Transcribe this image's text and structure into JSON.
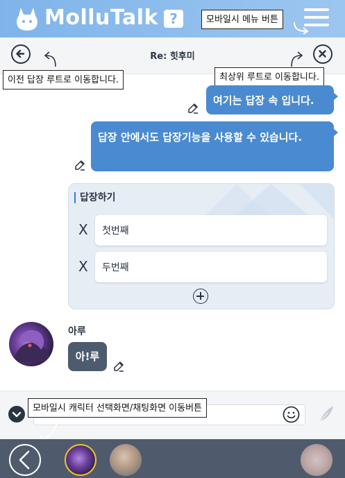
{
  "app": {
    "title": "MolluTalk",
    "help_label": "?",
    "brand_color": "#7fb4ea"
  },
  "thread": {
    "title": "Re: 힛후미",
    "back_icon": "arrow-left-circle-icon",
    "close_icon": "close-circle-icon"
  },
  "callouts": {
    "menu_button": "모바일시 메뉴 버튼",
    "prev_reply_root": "이전 답장 루트로 이동합니다.",
    "top_root": "최상위 루트로 이동합니다.",
    "mobile_switch": "모바일시 캐릭터 선택화면/채팅화면 이동버튼"
  },
  "messages": [
    {
      "text": "여기는 답장 속 입니다.",
      "side": "right",
      "color": "#4a8ad0"
    },
    {
      "text": "답장 안에서도 답장기능을 사용할 수 있습니다.",
      "side": "right",
      "color": "#4a8ad0"
    }
  ],
  "reply_block": {
    "title": "답장하기",
    "options": [
      {
        "remove_label": "X",
        "text": "첫번째"
      },
      {
        "remove_label": "X",
        "text": "두번째"
      }
    ],
    "add_icon": "plus-circle-icon"
  },
  "other_message": {
    "speaker": "아루",
    "text": "아!루",
    "bubble_color": "#4d5b6e"
  },
  "composer": {
    "emoji_icon": "smiley-icon",
    "send_icon": "feather-send-icon",
    "toggle_icon": "chevron-down-icon"
  },
  "bottom_nav": {
    "back_icon": "chevron-left-icon",
    "selected_border_color": "#f2c230"
  }
}
